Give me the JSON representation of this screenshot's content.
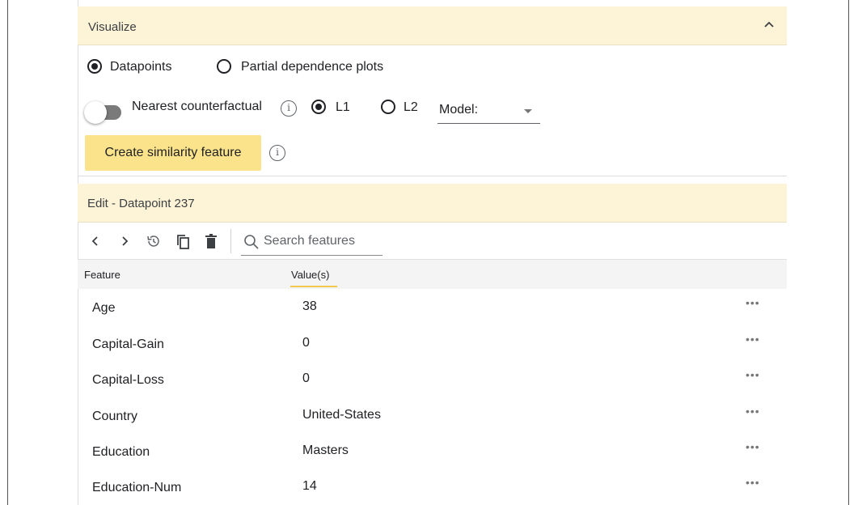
{
  "visualize": {
    "title": "Visualize",
    "options": {
      "datapoints_label": "Datapoints",
      "pdp_label": "Partial dependence plots",
      "selected": "Datapoints"
    },
    "counterfactual": {
      "label": "Nearest counterfactual",
      "l1_label": "L1",
      "l2_label": "L2",
      "selected_distance": "L1",
      "toggle_on": false
    },
    "model_select_label": "Model:",
    "similarity_button_label": "Create similarity feature"
  },
  "edit": {
    "title": "Edit - Datapoint 237",
    "search_placeholder": "Search features",
    "columns": {
      "feature": "Feature",
      "value": "Value(s)"
    },
    "rows": [
      {
        "feature": "Age",
        "value": "38"
      },
      {
        "feature": "Capital-Gain",
        "value": "0"
      },
      {
        "feature": "Capital-Loss",
        "value": "0"
      },
      {
        "feature": "Country",
        "value": "United-States"
      },
      {
        "feature": "Education",
        "value": "Masters"
      },
      {
        "feature": "Education-Num",
        "value": "14"
      }
    ],
    "more_label": "•••"
  },
  "colors": {
    "header_bg": "#fdf3d7",
    "button_bg": "#fbe38b",
    "accent_underline": "#f2c94c"
  }
}
